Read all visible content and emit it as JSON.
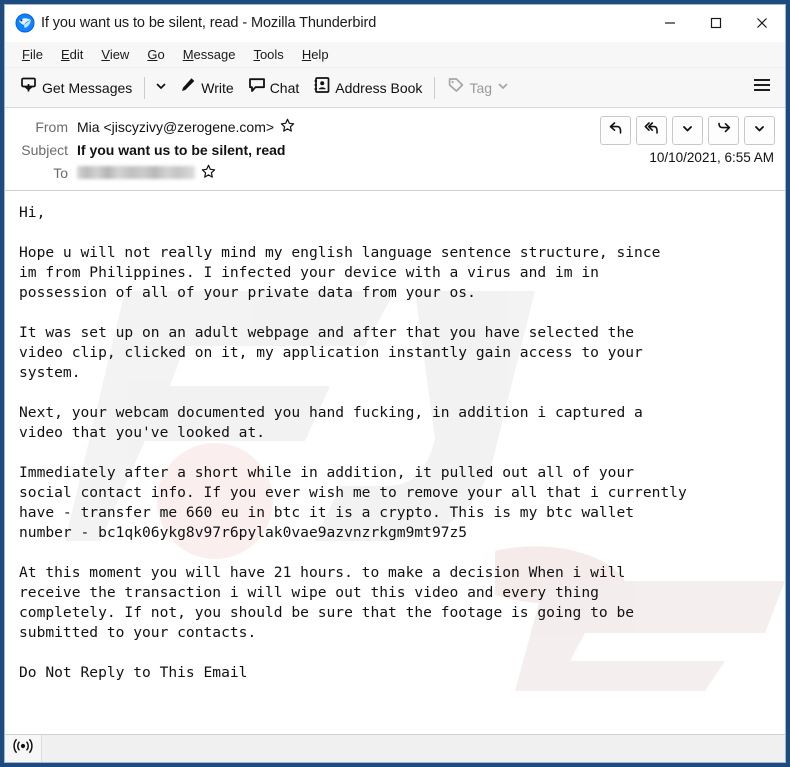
{
  "window": {
    "title": "If you want us to be silent, read - Mozilla Thunderbird",
    "app_icon": "thunderbird-logo-icon",
    "border_color": "#1e4b7f",
    "controls": {
      "minimize": "minimize-icon",
      "maximize": "maximize-icon",
      "close": "close-icon"
    }
  },
  "menubar": {
    "items": [
      {
        "accesskey": "F",
        "rest": "ile"
      },
      {
        "accesskey": "E",
        "rest": "dit"
      },
      {
        "accesskey": "V",
        "rest": "iew"
      },
      {
        "accesskey": "G",
        "rest": "o"
      },
      {
        "accesskey": "M",
        "rest": "essage"
      },
      {
        "accesskey": "T",
        "rest": "ools"
      },
      {
        "accesskey": "H",
        "rest": "elp"
      }
    ]
  },
  "toolbar": {
    "get_messages_label": "Get Messages",
    "write_label": "Write",
    "chat_label": "Chat",
    "address_book_label": "Address Book",
    "tag_label": "Tag",
    "tag_disabled": true,
    "menu_icon": "hamburger-menu-icon"
  },
  "message_header": {
    "from_label": "From",
    "from_value": "Mia <jiscyzivy@zerogene.com>",
    "subject_label": "Subject",
    "subject_value": "If you want us to be silent, read",
    "to_label": "To",
    "to_value_redacted": true,
    "date": "10/10/2021, 6:55 AM",
    "actions": [
      {
        "name": "reply-button",
        "icon": "reply-arrow-icon"
      },
      {
        "name": "reply-all-button",
        "icon": "reply-all-arrow-icon"
      },
      {
        "name": "reply-more-dropdown",
        "icon": "chevron-down-icon"
      },
      {
        "name": "forward-button",
        "icon": "forward-arrow-icon"
      },
      {
        "name": "forward-more-dropdown",
        "icon": "chevron-down-icon"
      }
    ]
  },
  "message_body": {
    "text": "Hi,\n\nHope u will not really mind my english language sentence structure, since\nim from Philippines. I infected your device with a virus and im in\npossession of all of your private data from your os.\n\nIt was set up on an adult webpage and after that you have selected the\nvideo clip, clicked on it, my application instantly gain access to your\nsystem.\n\nNext, your webcam documented you hand fucking, in addition i captured a\nvideo that you've looked at.\n\nImmediately after a short while in addition, it pulled out all of your\nsocial contact info. If you ever wish me to remove your all that i currently\nhave - transfer me 660 eu in btc it is a crypto. This is my btc wallet\nnumber - bc1qk06ykg8v97r6pylak0vae9azvnzrkgm9mt97z5\n\nAt this moment you will have 21 hours. to make a decision When i will\nreceive the transaction i will wipe out this video and every thing\ncompletely. If not, you should be sure that the footage is going to be\nsubmitted to your contacts.\n\nDo Not Reply to This Email",
    "btc_wallet": "bc1qk06ykg8v97r6pylak0vae9azvnzrkgm9mt97z5",
    "ransom_amount": "660 eu",
    "deadline": "21 hours"
  },
  "statusbar": {
    "connection_icon": "broadcast-online-icon"
  }
}
